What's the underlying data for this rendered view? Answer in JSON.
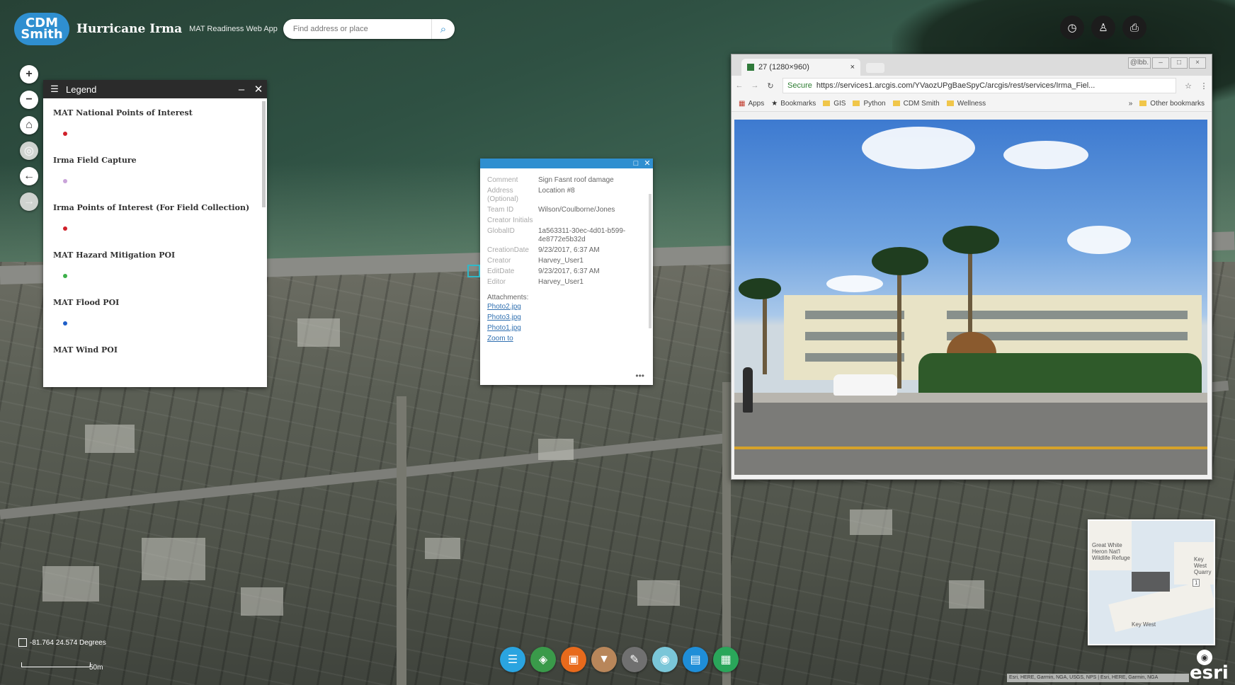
{
  "header": {
    "logo_line1": "CDM",
    "logo_line2": "Smith",
    "title": "Hurricane Irma",
    "subtitle": "MAT Readiness Web App",
    "search_placeholder": "Find address or place"
  },
  "icons": {
    "search": "search-icon",
    "history": "clock-icon",
    "person": "user-icon",
    "print": "printer-icon"
  },
  "left_nav": {
    "zoom_in": "+",
    "zoom_out": "−",
    "home": "⌂",
    "locate": "◎",
    "back": "←",
    "forward": "→"
  },
  "legend": {
    "title": "Legend",
    "minimize": "–",
    "close": "✕",
    "items": [
      {
        "label": "MAT National Points of Interest",
        "color": "#d0202a"
      },
      {
        "label": "Irma Field Capture",
        "color": "#c9a3d9"
      },
      {
        "label": "Irma Points of Interest (For Field Collection)",
        "color": "#d0202a"
      },
      {
        "label": "MAT Hazard Mitigation POI",
        "color": "#3cb04a"
      },
      {
        "label": "MAT Flood POI",
        "color": "#1f5fc8"
      },
      {
        "label": "MAT Wind POI",
        "color": "#333333"
      }
    ]
  },
  "popup": {
    "rows": [
      {
        "k": "Comment",
        "v": "Sign Fasnt roof damage"
      },
      {
        "k": "Address (Optional)",
        "v": "Location #8"
      },
      {
        "k": "Team ID",
        "v": "Wilson/Coulborne/Jones"
      },
      {
        "k": "Creator Initials",
        "v": ""
      },
      {
        "k": "GlobalID",
        "v": "1a563311-30ec-4d01-b599-4e8772e5b32d"
      },
      {
        "k": "CreationDate",
        "v": "9/23/2017, 6:37 AM"
      },
      {
        "k": "Creator",
        "v": "Harvey_User1"
      },
      {
        "k": "EditDate",
        "v": "9/23/2017, 6:37 AM"
      },
      {
        "k": "Editor",
        "v": "Harvey_User1"
      }
    ],
    "attachments_label": "Attachments:",
    "attachments": [
      "Photo2.jpg",
      "Photo3.jpg",
      "Photo1.jpg"
    ],
    "zoom_to": "Zoom to",
    "more": "•••",
    "maximize": "□",
    "close": "✕"
  },
  "browser": {
    "tab_title": "27 (1280×960)",
    "tab_close": "×",
    "win_user": "@lbb.",
    "win_min": "–",
    "win_max": "□",
    "win_close": "×",
    "secure": "Secure",
    "url": "https://services1.arcgis.com/YVaozUPgBaeSpyC/arcgis/rest/services/Irma_Fiel...",
    "bookmarks": [
      "Apps",
      "Bookmarks",
      "GIS",
      "Python",
      "CDM Smith",
      "Wellness"
    ],
    "more_bookmarks": "»",
    "other_bookmarks": "Other bookmarks"
  },
  "overview": {
    "label1": "Great White Heron Nat'l Wildlife Refuge",
    "label2": "Key West",
    "label3": "Key West Quarry",
    "num": "1"
  },
  "toolbar": {
    "buttons": [
      {
        "name": "list-icon",
        "glyph": "☰",
        "color": "#2aa4e0"
      },
      {
        "name": "layers-icon",
        "glyph": "◈",
        "color": "#3a9a4a"
      },
      {
        "name": "basemap-icon",
        "glyph": "▣",
        "color": "#e86a1c"
      },
      {
        "name": "filter-icon",
        "glyph": "▼",
        "color": "#b8865a"
      },
      {
        "name": "tools-icon",
        "glyph": "✎",
        "color": "#707070"
      },
      {
        "name": "globe-icon",
        "glyph": "◉",
        "color": "#7ac6d8"
      },
      {
        "name": "chart-icon",
        "glyph": "▤",
        "color": "#1f8ed8"
      },
      {
        "name": "report-icon",
        "glyph": "▦",
        "color": "#2aa65a"
      }
    ]
  },
  "footer": {
    "coords": "-81.764 24.574 Degrees",
    "scale_label": "50m",
    "esri": "esri",
    "attribution": "Esri, HERE, Garmin, NGA, USGS, NPS | Esri, HERE, Garmin, NGA"
  }
}
